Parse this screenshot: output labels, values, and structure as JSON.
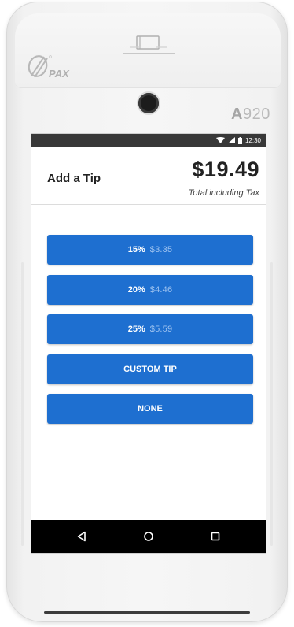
{
  "device": {
    "brand_logo": "PAX",
    "model_prefix": "A",
    "model_number": "920"
  },
  "status_bar": {
    "icons": [
      "wifi-icon",
      "signal-icon",
      "battery-icon"
    ],
    "time": "12:30"
  },
  "header": {
    "title": "Add a Tip",
    "amount": "$19.49",
    "subtitle": "Total including Tax"
  },
  "tip_options": [
    {
      "percent": "15%",
      "amount": "$3.35"
    },
    {
      "percent": "20%",
      "amount": "$4.46"
    },
    {
      "percent": "25%",
      "amount": "$5.59"
    }
  ],
  "custom_tip_label": "CUSTOM TIP",
  "none_label": "NONE",
  "nav_bar": {
    "icons": [
      "back-icon",
      "home-icon",
      "recents-icon"
    ]
  },
  "colors": {
    "primary_button": "#1e6fd0",
    "button_amount_text": "#9fc3f0",
    "status_bar": "#383838",
    "nav_bar": "#000000"
  }
}
